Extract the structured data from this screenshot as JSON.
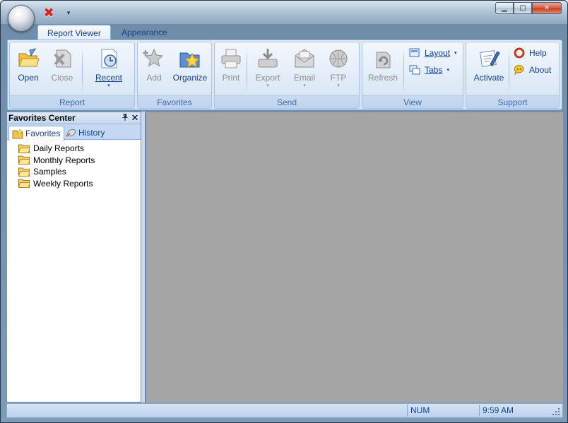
{
  "window": {
    "close_glyph": "✖",
    "qat_dropdown_glyph": "▾",
    "buttons": {
      "minimize": "▁",
      "maximize": "▢",
      "close": "✕"
    }
  },
  "ribbon": {
    "tabs": [
      {
        "label": "Report Viewer",
        "active": true
      },
      {
        "label": "Appearance",
        "active": false
      }
    ],
    "groups": {
      "report": {
        "label": "Report",
        "buttons": {
          "open": {
            "label": "Open",
            "icon": "open-folder-icon",
            "enabled": true
          },
          "close": {
            "label": "Close",
            "icon": "close-document-icon",
            "enabled": false
          },
          "recent": {
            "label": "Recent",
            "icon": "recent-clock-icon",
            "enabled": true,
            "dropdown": "▾"
          }
        }
      },
      "favorites": {
        "label": "Favorites",
        "buttons": {
          "add": {
            "label": "Add",
            "icon": "add-favorite-icon",
            "enabled": false
          },
          "organize": {
            "label": "Organize",
            "icon": "organize-favorites-icon",
            "enabled": true
          }
        }
      },
      "send": {
        "label": "Send",
        "buttons": {
          "print": {
            "label": "Print",
            "icon": "printer-icon",
            "enabled": false
          },
          "export": {
            "label": "Export",
            "icon": "export-icon",
            "enabled": false,
            "dropdown": "▾"
          },
          "email": {
            "label": "Email",
            "icon": "email-icon",
            "enabled": false,
            "dropdown": "▾"
          },
          "ftp": {
            "label": "FTP",
            "icon": "ftp-globe-icon",
            "enabled": false,
            "dropdown": "▾"
          }
        }
      },
      "view": {
        "label": "View",
        "buttons": {
          "refresh": {
            "label": "Refresh",
            "icon": "refresh-icon",
            "enabled": false
          },
          "layout": {
            "label": "Layout",
            "icon": "layout-icon",
            "dropdown": "▾"
          },
          "tabs": {
            "label": "Tabs",
            "icon": "tabs-icon",
            "dropdown": "▾"
          }
        }
      },
      "support": {
        "label": "Support",
        "buttons": {
          "activate": {
            "label": "Activate",
            "icon": "activate-certificate-icon",
            "enabled": true
          },
          "help": {
            "label": "Help",
            "icon": "help-lifebuoy-icon"
          },
          "about": {
            "label": "About",
            "icon": "about-info-icon"
          }
        }
      }
    }
  },
  "favorites_pane": {
    "title": "Favorites Center",
    "pin_glyph": "📌",
    "close_glyph": "✕",
    "tabs": [
      {
        "label": "Favorites",
        "icon": "favorites-folder-icon",
        "active": true
      },
      {
        "label": "History",
        "icon": "history-icon",
        "active": false
      }
    ],
    "items": [
      {
        "label": "Daily Reports"
      },
      {
        "label": "Monthly Reports"
      },
      {
        "label": "Samples"
      },
      {
        "label": "Weekly Reports"
      }
    ]
  },
  "statusbar": {
    "main_text": "",
    "num": "NUM",
    "time": "9:59 AM"
  },
  "colors": {
    "accent": "#15428b",
    "ribbon_border": "#8db2e3",
    "content_bg": "#a5a5a5",
    "disabled_text": "#8d8d8d"
  }
}
